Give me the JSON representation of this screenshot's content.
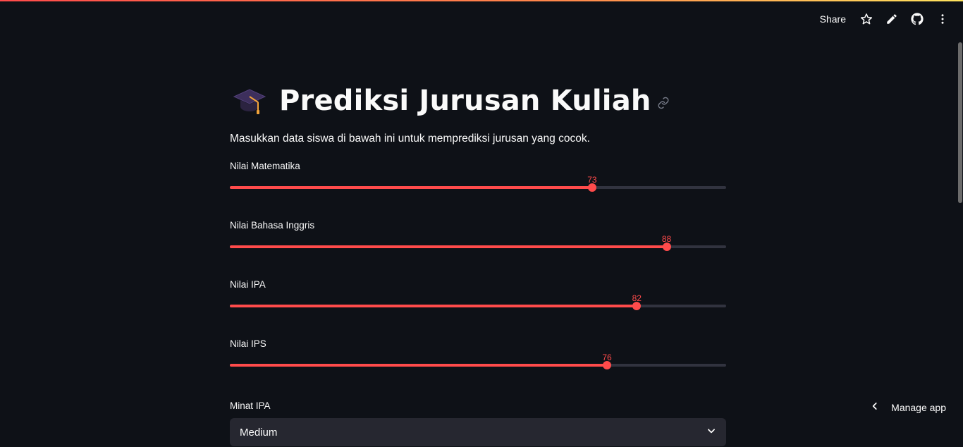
{
  "toolbar": {
    "share_label": "Share",
    "icons": [
      "star-icon",
      "pencil-icon",
      "github-icon",
      "more-vertical-icon"
    ]
  },
  "app": {
    "title": "Prediksi Jurusan Kuliah",
    "title_icon": "graduation-cap-icon",
    "description": "Masukkan data siswa di bawah ini untuk memprediksi jurusan yang cocok."
  },
  "sliders": [
    {
      "label": "Nilai Matematika",
      "value": "73",
      "min": 0,
      "max": 100
    },
    {
      "label": "Nilai Bahasa Inggris",
      "value": "88",
      "min": 0,
      "max": 100
    },
    {
      "label": "Nilai IPA",
      "value": "82",
      "min": 0,
      "max": 100
    },
    {
      "label": "Nilai IPS",
      "value": "76",
      "min": 0,
      "max": 100
    }
  ],
  "minat_ipa": {
    "label": "Minat IPA",
    "selected": "Medium"
  },
  "manage_app": {
    "label": "Manage app"
  },
  "colors": {
    "accent": "#ff4b4b",
    "background": "#0e1117",
    "track": "#31333f",
    "select_bg": "#262730"
  }
}
